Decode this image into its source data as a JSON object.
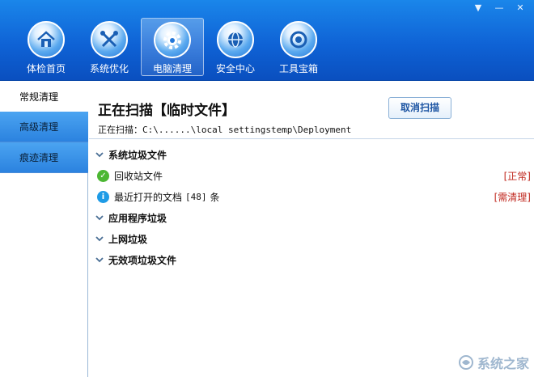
{
  "window": {
    "controls": [
      "▼",
      "—",
      "✕"
    ]
  },
  "nav": {
    "items": [
      {
        "label": "体检首页",
        "icon": "home-icon"
      },
      {
        "label": "系统优化",
        "icon": "tools-icon"
      },
      {
        "label": "电脑清理",
        "icon": "gear-icon",
        "active": true
      },
      {
        "label": "安全中心",
        "icon": "globe-icon"
      },
      {
        "label": "工具宝箱",
        "icon": "aperture-icon"
      }
    ]
  },
  "sidebar": {
    "items": [
      {
        "label": "常规清理",
        "active": true
      },
      {
        "label": "高级清理"
      },
      {
        "label": "痕迹清理"
      }
    ]
  },
  "main": {
    "title": "正在扫描【临时文件】",
    "cancel_label": "取消扫描",
    "scan_prefix": "正在扫描：",
    "scan_path": "C:\\......\\local settingstemp\\Deployment"
  },
  "tree": {
    "group1": "系统垃圾文件",
    "leaf1": {
      "label": "回收站文件",
      "status": "[正常]"
    },
    "leaf2": {
      "label": "最近打开的文档",
      "count": "[48]",
      "unit": "条",
      "status": "[需清理]"
    },
    "group2": "应用程序垃圾",
    "group3": "上网垃圾",
    "group4": "无效项垃圾文件"
  },
  "watermark": {
    "text": "系统之家"
  },
  "colors": {
    "header": "#0f63d6",
    "accent": "#2b82df",
    "warn": "#c0281f",
    "ok": "#4cb733",
    "info": "#1e9be6"
  }
}
